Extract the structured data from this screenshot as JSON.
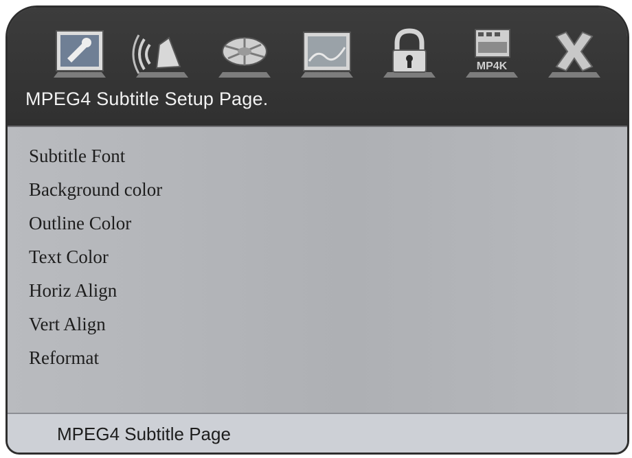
{
  "header": {
    "title": "MPEG4 Subtitle Setup Page.",
    "tabs": [
      {
        "icon": "general-setup-icon"
      },
      {
        "icon": "audio-setup-icon"
      },
      {
        "icon": "dolby-setup-icon"
      },
      {
        "icon": "video-setup-icon"
      },
      {
        "icon": "lock-icon"
      },
      {
        "icon": "mpeg4-icon",
        "label": "MP4K"
      },
      {
        "icon": "exit-icon"
      }
    ]
  },
  "menu": {
    "items": [
      "Subtitle Font",
      "Background color",
      "Outline Color",
      "Text Color",
      "Horiz Align",
      "Vert Align",
      "Reformat"
    ]
  },
  "status": {
    "text": "MPEG4 Subtitle Page"
  }
}
